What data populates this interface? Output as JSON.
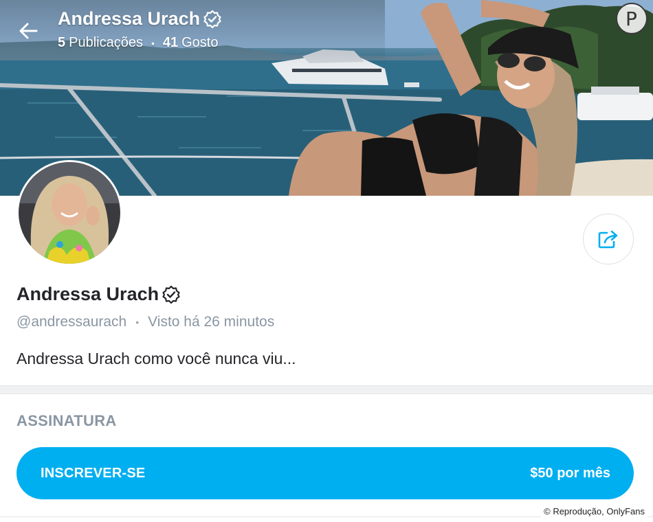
{
  "header": {
    "name": "Andressa Urach",
    "posts_count": "5",
    "posts_label": "Publicações",
    "likes_count": "41",
    "likes_label": "Gosto",
    "separator": "•"
  },
  "watermark": {
    "logo_letter": "P"
  },
  "profile": {
    "name": "Andressa Urach",
    "username": "@andressaurach",
    "separator": "•",
    "last_seen": "Visto há 26 minutos",
    "bio": "Andressa Urach como você nunca viu..."
  },
  "subscription": {
    "section_title": "ASSINATURA",
    "button_label": "INSCREVER-SE",
    "price": "$50 por mês"
  },
  "credit": "© Reprodução, OnlyFans",
  "icons": {
    "back": "arrow-left-icon",
    "verified": "verified-badge-icon",
    "share": "share-icon"
  },
  "colors": {
    "accent": "#00aff0",
    "text_primary": "#242529",
    "text_secondary": "#8a96a3",
    "divider": "#f0f1f3"
  }
}
